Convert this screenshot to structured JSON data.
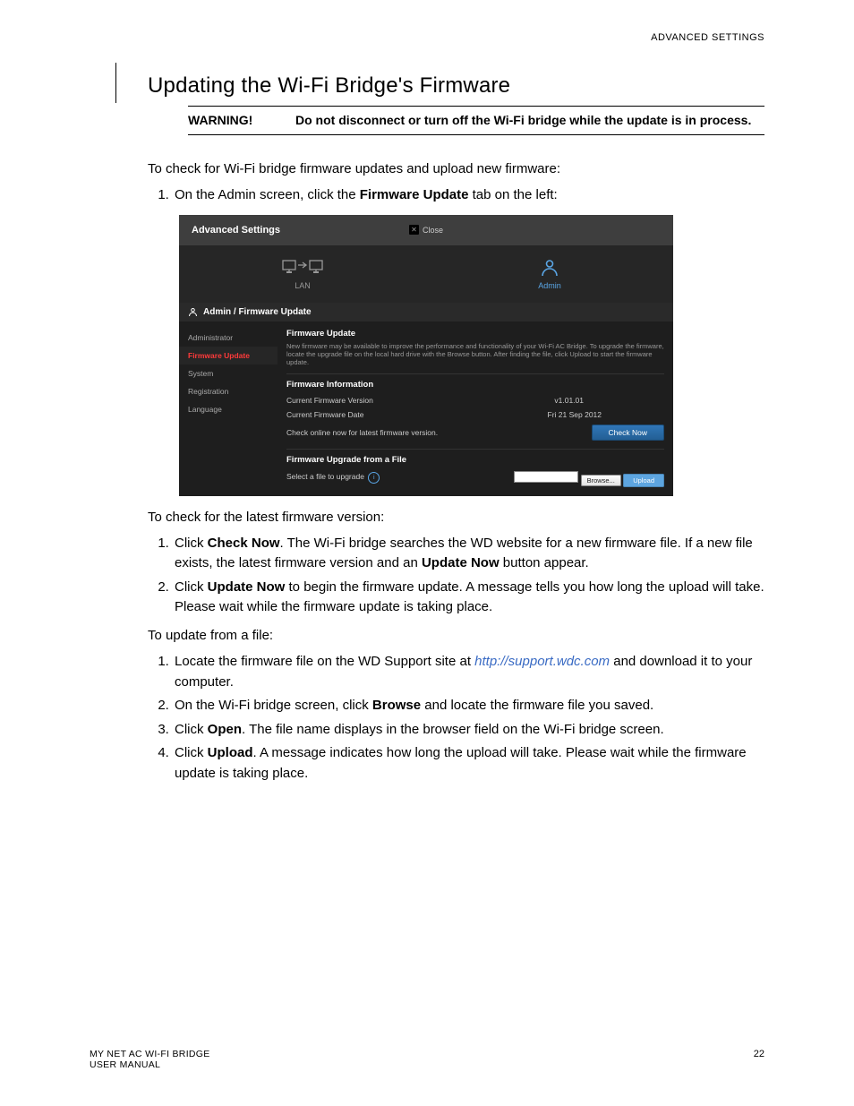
{
  "header": "ADVANCED SETTINGS",
  "section_title": "Updating the Wi-Fi Bridge's Firmware",
  "warning": {
    "label": "WARNING!",
    "text": "Do not disconnect or turn off the Wi-Fi bridge while the update is in process."
  },
  "intro1": "To check for Wi-Fi bridge firmware updates and upload new firmware:",
  "step1": {
    "pre": "On the Admin screen, click the ",
    "bold": "Firmware Update",
    "post": " tab on the left:"
  },
  "ui": {
    "title_bar": "Advanced Settings",
    "close": "Close",
    "tab_lan": "LAN",
    "tab_admin": "Admin",
    "breadcrumb": "Admin / Firmware Update",
    "sidebar": {
      "admin": "Administrator",
      "fw": "Firmware Update",
      "system": "System",
      "reg": "Registration",
      "lang": "Language"
    },
    "panel": {
      "heading": "Firmware Update",
      "desc": "New firmware may be available to improve the performance and functionality of your Wi-Fi AC Bridge. To upgrade the firmware, locate the upgrade file on the local hard drive with the Browse button. After finding the file, click Upload to start the firmware update.",
      "info_heading": "Firmware Information",
      "cur_ver_label": "Current Firmware Version",
      "cur_ver_value": "v1.01.01",
      "cur_date_label": "Current Firmware Date",
      "cur_date_value": "Fri 21 Sep 2012",
      "check_label": "Check online now for latest firmware version.",
      "check_btn": "Check Now",
      "upgrade_heading": "Firmware Upgrade from a File",
      "select_label": "Select a file to upgrade",
      "browse_btn": "Browse...",
      "upload_btn": "Upload"
    }
  },
  "intro2": "To check for the latest firmware version:",
  "list2": {
    "i1": {
      "pre": "Click ",
      "b1": "Check Now",
      "mid": ". The Wi-Fi bridge searches the WD website for a new firmware file. If a new file exists, the latest firmware version and an ",
      "b2": "Update Now",
      "post": " button appear."
    },
    "i2": {
      "pre": "Click ",
      "b1": "Update Now",
      "post": " to begin the firmware update. A message tells you how long the upload will take. Please wait while the firmware update is taking place."
    }
  },
  "intro3": "To update from a file:",
  "list3": {
    "i1": {
      "pre": "Locate the firmware file on the WD Support site at ",
      "link": "http://support.wdc.com",
      "post": " and download it to your computer."
    },
    "i2": {
      "pre": "On the Wi-Fi bridge screen, click ",
      "b1": "Browse",
      "post": " and locate the firmware file you saved."
    },
    "i3": {
      "pre": "Click ",
      "b1": "Open",
      "post": ". The file name displays in the browser field on the Wi-Fi bridge screen."
    },
    "i4": {
      "pre": "Click ",
      "b1": "Upload",
      "post": ". A message indicates how long the upload will take. Please wait while the firmware update is taking place."
    }
  },
  "footer": {
    "line1": "MY NET AC WI-FI BRIDGE",
    "line2": "USER MANUAL",
    "page": "22"
  }
}
